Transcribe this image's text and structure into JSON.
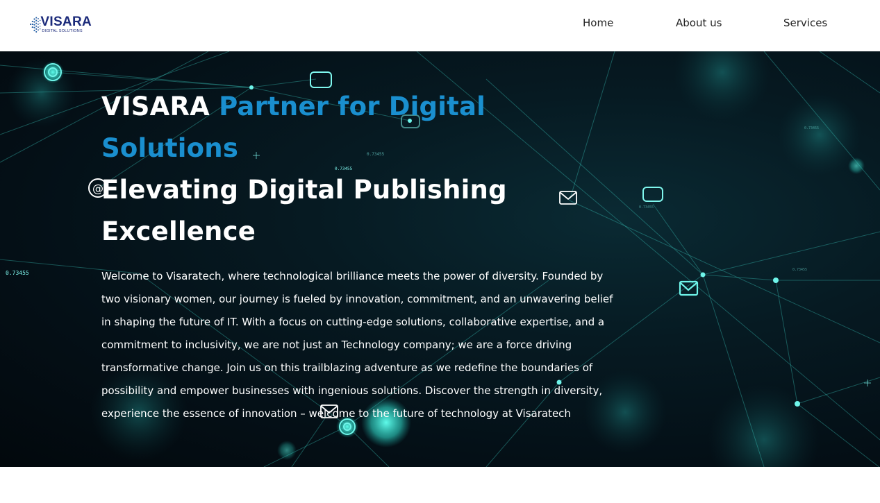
{
  "brand": {
    "logo_word": "VISARA",
    "logo_sub": "DIGITAL SOLUTIONS",
    "colors": {
      "navy": "#1b2a7a",
      "accent_blue": "#1a8fcf",
      "glow_cyan": "#3ff0e0"
    }
  },
  "nav": {
    "home": "Home",
    "about": "About us",
    "services": "Services"
  },
  "hero": {
    "brand_word": "VISARA",
    "accent_phrase": "Partner for Digital Solutions",
    "headline_rest": "Elevating Digital Publishing Excellence",
    "intro": "Welcome to Visaratech, where technological brilliance meets the power of diversity. Founded by two visionary women, our journey is fueled by innovation, commitment, and an unwavering belief in shaping the future of IT. With a focus on cutting-edge solutions, collaborative expertise, and a commitment to inclusivity, we are not just an Technology company; we are a force driving transformative change. Join us on this trailblazing adventure as we redefine the boundaries of possibility and empower businesses with ingenious solutions. Discover the strength in diversity, experience the essence of innovation – welcome to the future of technology at Visaratech",
    "bg_labels": [
      "0.73455",
      "0.73455",
      "0.73455",
      "0.73455",
      "0.73455",
      "0.73455"
    ],
    "bg_icons": [
      "mail-icon",
      "at-sign-icon",
      "target-icon",
      "gamepad-icon"
    ]
  }
}
